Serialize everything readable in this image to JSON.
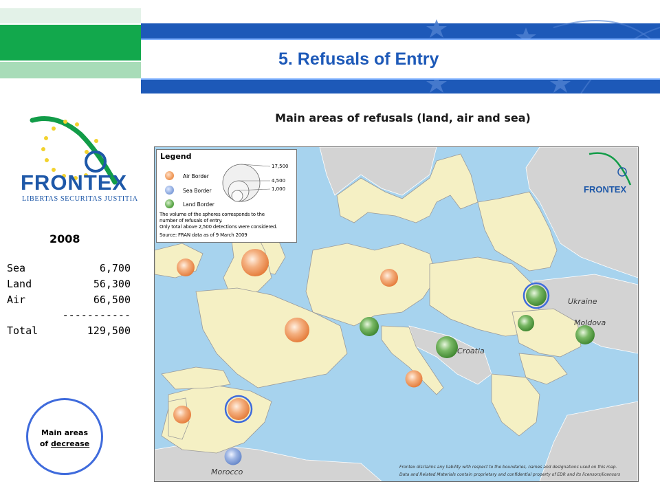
{
  "header": {
    "title": "5. Refusals of Entry"
  },
  "logo": {
    "wordmark": "FRONTEX",
    "motto": "LIBERTAS SECURITAS JUSTITIA"
  },
  "stats": {
    "year": "2008",
    "rows": [
      {
        "label": "Sea",
        "value": "6,700"
      },
      {
        "label": "Land",
        "value": "56,300"
      },
      {
        "label": "Air",
        "value": "66,500"
      },
      {
        "label": "",
        "value": "-----------"
      },
      {
        "label": "Total",
        "value": "129,500"
      }
    ]
  },
  "decrease_note": {
    "line1": "Main areas",
    "line2_prefix": "of ",
    "line2_emph": "decrease"
  },
  "map": {
    "title": "Main areas of refusals (land, air and sea)",
    "legend": {
      "title": "Legend",
      "items": [
        {
          "name": "air-border",
          "label": "Air Border",
          "color": "#f09a5a"
        },
        {
          "name": "sea-border",
          "label": "Sea Border",
          "color": "#8aa7de"
        },
        {
          "name": "land-border",
          "label": "Land Border",
          "color": "#5da84a"
        }
      ],
      "sizes": [
        "17,500",
        "4,500",
        "1,000"
      ],
      "note_line1": "The volume of the spheres corresponds to the",
      "note_line2": "number of refusals of entry.",
      "note_line3": "Only total above 2,500 detections were considered.",
      "source": "Source: FRAN data as of 9 March 2009"
    },
    "map_logo": "FRONTEX",
    "country_labels": {
      "ukraine": "Ukraine",
      "moldova": "Moldova",
      "croatia": "Croatia",
      "morocco": "Morocco"
    },
    "disclaimer_line1": "Frontex disclaims any liability with respect to the boundaries, names and designations used on this map.",
    "disclaimer_line2": "Data and Related Materials contain proprietary and confidential property of EDR and its licensors/licensors",
    "colors": {
      "air": "#f09a5a",
      "sea": "#8aa7de",
      "land": "#5da84a",
      "decrease_ring": "#3f6bdc",
      "land_fill": "#f5f0c4",
      "non_eu_land": "#d3d3d3",
      "water": "#a7d3ee"
    }
  }
}
